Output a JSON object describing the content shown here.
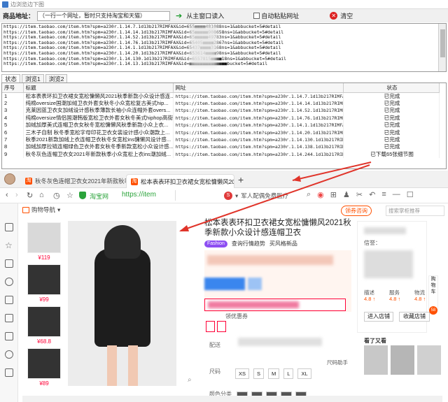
{
  "tool": {
    "window_title": "边浏览边下图",
    "goods_label": "商品地址：",
    "goods_hint": "（一行一个网址，暂时只支持淘宝和天猫）",
    "read_button": "从主窗口读入",
    "auto_paste_label": "自动粘贴网址",
    "clear_label": "清空",
    "url_lines": [
      "https://item.taobao.com/item.htm?spm=a230r.1.14.7.1d13b217RIMFAX&id=655■■■■481088ns=1&abbucket=5#detail",
      "https://item.taobao.com/item.htm?spm=a230r.1.14.14.1d13b217RIMFAX&id=65■■■■■908658ns=1&abbucket=5#detail",
      "https://item.taobao.com/item.htm?spm=a230r.1.14.52.1d13b217RIMFAX&id=65■■■■■49783ns=1&abbucket=5#detail",
      "https://item.taobao.com/item.htm?spm=a230r.1.14.76.1d13b217RIMFAX&id=65405■■■■2867ns=1&abbucket=5#detail",
      "https://item.taobao.com/item.htm?spm=a230r.1.14.1.1d13b217RIMFAX&id=65437■■■■3168ns=1&abbucket=5#detail",
      "https://item.taobao.com/item.htm?spm=a230r.1.14.20.1d13b217RIMFAX&id=653614■■■■98ns=1&abbucket=5#detail",
      "https://item.taobao.com/item.htm?spm=a230r.1.14.130.1d13b217RIMFAX&id=6557815■■■■18ns=1&abbucket=5#detail",
      "https://item.taobao.com/item.htm?spm=a230r.1.14.13.1d13b217RIMFAX&id=■■■■■■■■■■■■■■bucket=5#detail"
    ],
    "tabs": [
      "状态",
      "浏览1",
      "浏览2"
    ],
    "table": {
      "columns": [
        "序号",
        "标题",
        "网址",
        "状态"
      ],
      "rows": [
        {
          "no": "1",
          "title": "松本表表环扣卫衣裙女宽松慵懒风2021秋季新款小众设计感连...",
          "url": "https://item.taobao.com/item.htm?spm=a230r.1.14.7.1d13b217RIMFAX&...",
          "status": "已完成"
        },
        {
          "no": "2",
          "title": "纯棉oversize国潮加绒卫衣外套女秋冬小众宽松复古美式hip...",
          "url": "https://item.taobao.com/item.htm?spm=a230r.1.14.14.1d13b217RIMFAX...",
          "status": "已完成"
        },
        {
          "no": "3",
          "title": "克莱因蓝卫衣女加绒设计感秋季薄款长袖小众连帽外套overs...",
          "url": "https://item.taobao.com/item.htm?spm=a230r.1.14.52.1d13b217RIMFAX...",
          "status": "已完成"
        },
        {
          "no": "4",
          "title": "纯棉oversize情侣国潮韩版宽松卫衣外套女秋冬美式hiphop高街...",
          "url": "https://item.taobao.com/item.htm?spm=a230r.1.14.76.1d13b217RIMFAX...",
          "status": "已完成"
        },
        {
          "no": "5",
          "title": "加绒加厚美式连帽卫衣女秋冬宽松慵懒风秋季新款小众上衣...",
          "url": "https://item.taobao.com/item.htm?spm=a230r.1.14.1.1d13b217RIMFAX&...",
          "status": "已完成"
        },
        {
          "no": "6",
          "title": "三木子自制  秋冬季宽松字母印花卫衣女装设计感小众潮款上...",
          "url": "https://item.taobao.com/item.htm?spm=a230r.1.14.20.1d13b217RIMFAX...",
          "status": "已完成"
        },
        {
          "no": "7",
          "title": "秋季2021新款加绒上衣连帽卫衣秋冬女宽松ins慵懒风设计感...",
          "url": "https://item.taobao.com/item.htm?spm=a230r.1.14.130.1d13b217RIMFA...",
          "status": "已完成"
        },
        {
          "no": "8",
          "title": "加绒加厚拉链连帽绿色卫衣外套女秋冬季新款宽松小众设计感...",
          "url": "https://item.taobao.com/item.htm?spm=a230r.1.14.138.1d13b217RIMFA...",
          "status": "已完成"
        },
        {
          "no": "9",
          "title": "秋冬灰色连帽卫衣女2021年新款秋季小众宽松上衣ins潮加绒...",
          "url": "https://item.taobao.com/item.htm?spm=a230r.1.14.244.1d13b217RIMFA...",
          "status": "已下载65张细节图"
        }
      ]
    }
  },
  "browser": {
    "tab1_title": "秋冬灰色连帽卫衣女2021年新款秋季...",
    "tab2_title": "松本表表环扣卫衣裙女宽松慵懒风2021秋...",
    "site_name": "淘宝网",
    "url_text": "https://item",
    "search_tip": "军人配偶免费医疗",
    "shop_nav": "购物导航",
    "consult": "领券咨询",
    "shop_search_placeholder": "搜索掌柜推荐",
    "thumb_prices": [
      "¥119",
      "¥99",
      "¥68.8",
      "¥89"
    ],
    "product_title": "松本表表环扣卫衣裙女宽松慵懒风2021秋季新款小众设计感连帽卫衣",
    "tag_fashion": "Fashion",
    "tag_trend": "查询行情趋势",
    "tag_buy": "买风格新品",
    "coupon": "领优惠券",
    "delivery_label": "配送",
    "size_label": "尺码",
    "fit_tip": "尺码助手",
    "sizes": [
      "XS",
      "S",
      "M",
      "L",
      "XL"
    ],
    "color_label": "颜色分类",
    "right_credit": "信誉：",
    "ratings": [
      {
        "label": "描述",
        "value": "4.8 ↑"
      },
      {
        "label": "服务",
        "value": "4.8 ↑"
      },
      {
        "label": "物流",
        "value": "4.8 ↑"
      }
    ],
    "enter_store": "进入店铺",
    "fav_store": "收藏店铺",
    "see_also": "看了又看",
    "cart_label": "购物车",
    "cart_count": "58"
  }
}
